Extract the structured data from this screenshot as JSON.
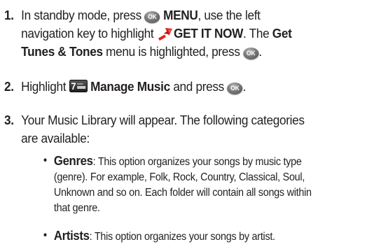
{
  "steps": [
    {
      "number": "1.",
      "line1_pre": "In standby mode, press ",
      "ok_key_label": "OK",
      "menu_label": "MENU",
      "line1_post": ", use the left",
      "line2_pre": "navigation key to highlight ",
      "get_it_now_label": "GET IT NOW",
      "line2_mid": ". The ",
      "line2_get": "Get",
      "line3_bold": "Tunes & Tones",
      "line3_mid": " menu is highlighted, press ",
      "line3_end": "."
    },
    {
      "number": "2.",
      "pre": "Highlight ",
      "vcast_icon_label": "7",
      "bold": "Manage Music",
      "mid": " and press ",
      "end": "."
    },
    {
      "number": "3.",
      "line1": "Your Music Library will appear. The following categories",
      "line2": "are available:"
    }
  ],
  "bullets": [
    {
      "term": "Genres",
      "lines": [
        ": This option organizes your songs by music type",
        "(genre). For example, Folk, Rock, Country, Classical, Soul,",
        "Unknown and so on. Each folder will contain all songs within",
        "that genre."
      ]
    },
    {
      "term": "Artists",
      "lines": [
        ": This option organizes your songs by artist."
      ]
    }
  ],
  "icons": {
    "ok_key": "ok-key-icon",
    "get_it_now": "get-it-now-icon",
    "vcast_music": "vcast-music-icon"
  },
  "colors": {
    "text": "#231f20",
    "get_it_now_red": "#e2231a",
    "ok_key_gray": "#6e6e6e"
  }
}
